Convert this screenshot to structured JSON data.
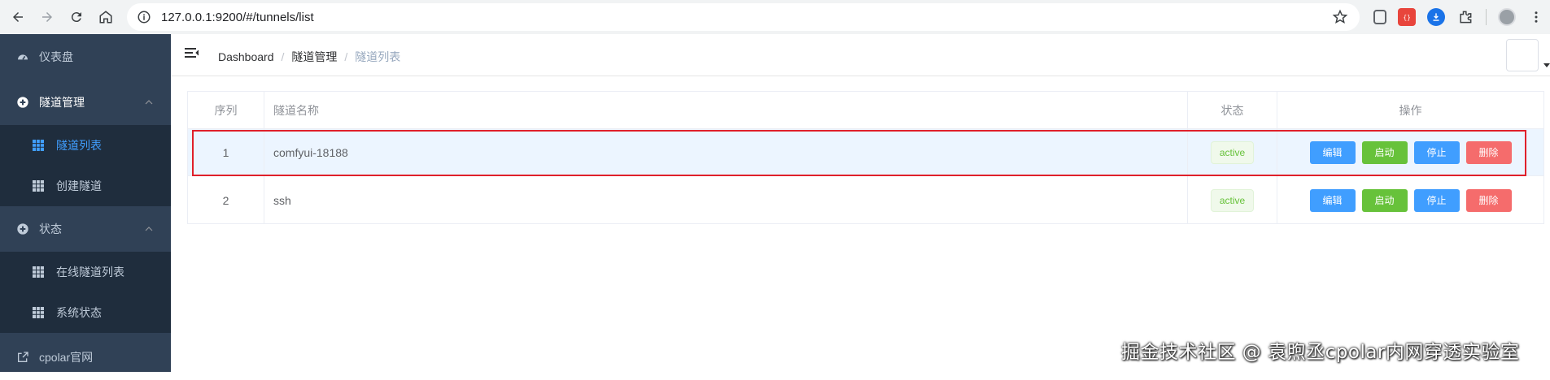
{
  "browser": {
    "url": "127.0.0.1:9200/#/tunnels/list"
  },
  "sidebar": {
    "items": [
      {
        "label": "仪表盘"
      },
      {
        "label": "隧道管理",
        "children": [
          {
            "label": "隧道列表"
          },
          {
            "label": "创建隧道"
          }
        ]
      },
      {
        "label": "状态",
        "children": [
          {
            "label": "在线隧道列表"
          },
          {
            "label": "系统状态"
          }
        ]
      },
      {
        "label": "cpolar官网"
      }
    ],
    "active_item": "隧道列表"
  },
  "header": {
    "breadcrumb": [
      "Dashboard",
      "隧道管理",
      "隧道列表"
    ],
    "separator": "/"
  },
  "table": {
    "columns": [
      "序列",
      "隧道名称",
      "状态",
      "操作"
    ],
    "rows": [
      {
        "index": "1",
        "name": "comfyui-18188",
        "status": "active"
      },
      {
        "index": "2",
        "name": "ssh",
        "status": "active"
      }
    ],
    "actions": {
      "edit": "编辑",
      "start": "启动",
      "stop": "停止",
      "delete": "删除"
    }
  },
  "colors": {
    "sidebar_bg": "#304156",
    "submenu_bg": "#1f2d3d",
    "accent": "#409eff",
    "success": "#67c23a",
    "danger": "#f56c6c",
    "highlight_box": "#e0202a"
  },
  "watermark": "掘金技术社区 @ 袁煦丞cpolar内网穿透实验室"
}
